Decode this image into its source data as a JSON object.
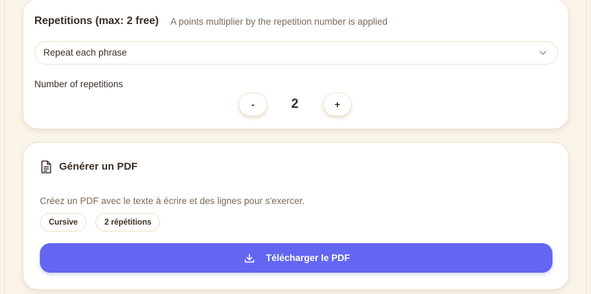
{
  "repetitions": {
    "title": "Repetitions (max: 2 free)",
    "subtitle": "A points multiplier by the repetition number is applied",
    "mode_select": {
      "value": "Repeat each phrase"
    },
    "count_label": "Number of repetitions",
    "minus_label": "-",
    "count_value": "2",
    "plus_label": "+"
  },
  "pdf": {
    "icon": "file-text-icon",
    "title": "Générer un PDF",
    "description": "Créez un PDF avec le texte à écrire et des lignes pour s'exercer.",
    "badges": [
      "Cursive",
      "2 répétitions"
    ],
    "download_icon": "download-icon",
    "download_label": "Télécharger le PDF"
  },
  "colors": {
    "page_background": "#fbf4e9",
    "card_background": "#ffffff",
    "accent": "#6366f1",
    "text_primary": "#3a2f27",
    "text_secondary": "#7a6a58"
  }
}
